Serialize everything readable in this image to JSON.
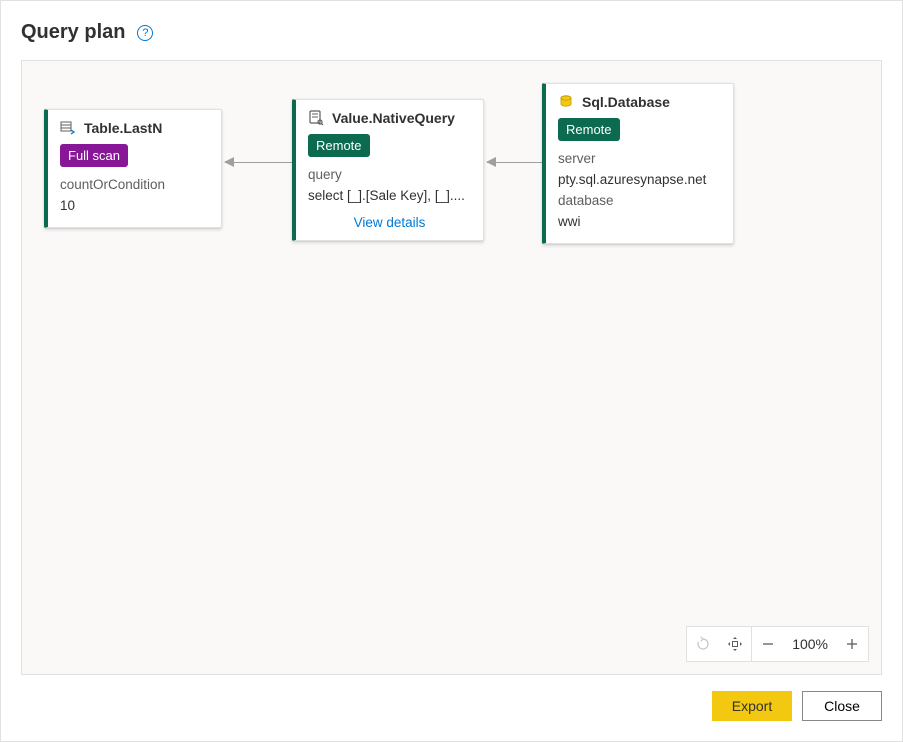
{
  "header": {
    "title": "Query plan"
  },
  "nodes": [
    {
      "title": "Table.LastN",
      "badge": "Full scan",
      "badgeClass": "badge-purple",
      "field1": "countOrCondition",
      "value1": "10"
    },
    {
      "title": "Value.NativeQuery",
      "badge": "Remote",
      "badgeClass": "badge-teal",
      "field1": "query",
      "value1": "select [_].[Sale Key], [_]....",
      "details": "View details"
    },
    {
      "title": "Sql.Database",
      "badge": "Remote",
      "badgeClass": "badge-teal",
      "field1": "server",
      "value1": "pty.sql.azuresynapse.net",
      "field2": "database",
      "value2": "wwi"
    }
  ],
  "zoom": {
    "label": "100%"
  },
  "footer": {
    "export": "Export",
    "close": "Close"
  }
}
